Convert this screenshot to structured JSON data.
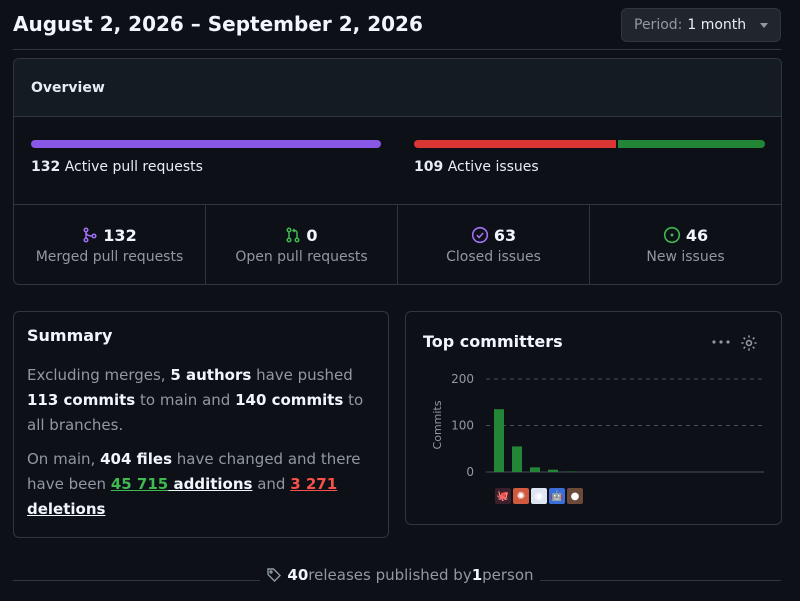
{
  "header": {
    "title": "August 2, 2026 – September 2, 2026",
    "period_label": "Period:",
    "period_value": "1 month"
  },
  "overview": {
    "title": "Overview",
    "pr_bar": {
      "count": "132",
      "label": "Active pull requests",
      "merged_fraction": 1.0,
      "color": "#8957e5"
    },
    "issue_bar": {
      "count": "109",
      "label": "Active issues",
      "closed_fraction": 0.578,
      "closed_color": "#da3633",
      "new_color": "#238636"
    },
    "stats": [
      {
        "value": "132",
        "label": "Merged pull requests",
        "icon": "merge-icon",
        "color": "#a371f7"
      },
      {
        "value": "0",
        "label": "Open pull requests",
        "icon": "pull-request-icon",
        "color": "#3fb950"
      },
      {
        "value": "63",
        "label": "Closed issues",
        "icon": "issue-closed-icon",
        "color": "#a371f7"
      },
      {
        "value": "46",
        "label": "New issues",
        "icon": "issue-opened-icon",
        "color": "#3fb950"
      }
    ]
  },
  "summary": {
    "title": "Summary",
    "p1": {
      "t1": "Excluding merges, ",
      "authors": "5 authors",
      "t2": " have pushed ",
      "commits_main": "113 commits",
      "t3": " to main and ",
      "commits_all": "140 commits",
      "t4": " to all branches."
    },
    "p2": {
      "t1": "On main, ",
      "files": "404 files",
      "t2": " have changed and there have been ",
      "additions_num": "45 715",
      "additions_word": " additions",
      "t3": " and ",
      "deletions_num": "3 271",
      "deletions_word": " deletions"
    }
  },
  "committers": {
    "title": "Top committers",
    "chart_data": {
      "type": "bar",
      "categories": [
        "1",
        "2",
        "3",
        "4",
        "5"
      ],
      "values": [
        135,
        55,
        10,
        5,
        1
      ],
      "ylabel": "Commits",
      "yticks": [
        "200",
        "100",
        "0"
      ],
      "ylim": [
        0,
        200
      ],
      "color": "#238636"
    },
    "avatars": [
      {
        "name": "committer-1",
        "bg": "#3b1f2b",
        "glyph": "🐙"
      },
      {
        "name": "committer-2",
        "bg": "#d05a3f",
        "glyph": "✺"
      },
      {
        "name": "committer-3",
        "bg": "#dfe6f3",
        "glyph": "◉"
      },
      {
        "name": "committer-4",
        "bg": "#3a6ed8",
        "glyph": "🤖"
      },
      {
        "name": "committer-5",
        "bg": "#6b4a3a",
        "glyph": "●"
      }
    ]
  },
  "footer": {
    "releases": "40",
    "t1": " releases published by ",
    "people": "1",
    "t2": " person"
  }
}
